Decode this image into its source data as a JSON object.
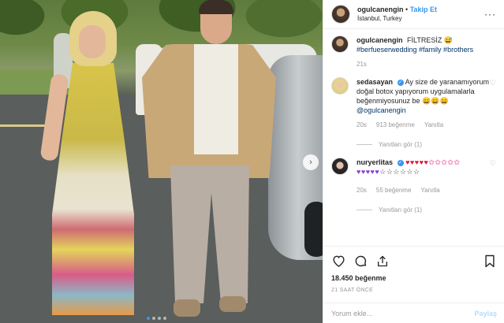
{
  "post": {
    "username": "ogulcanengin",
    "follow_label": "Takip Et",
    "separator": "•",
    "location": "İstanbul, Turkey",
    "menu_icon": "more-horizontal-icon"
  },
  "caption": {
    "username": "ogulcanengin",
    "text": "FİLTRESİZ",
    "emoji": "😅",
    "hashtags": "#berfueserwedding #family #brothers",
    "time": "21s"
  },
  "comments": [
    {
      "username": "sedasayan",
      "text": "Ay size de yaranamıyorum doğal botox yapıyorum uygulamalarla beğenmiyosunuz be 😄😄😄",
      "mention": "@ogulcanengin",
      "time": "20s",
      "likes": "913 beğenme",
      "reply": "Yanıtla",
      "view_replies": "Yanıtları gör (1)"
    },
    {
      "username": "nuryerlitas",
      "hearts_line1_red": "♥♥♥♥♥",
      "hearts_line1_pink": "✿✿✿✿✿",
      "hearts_line2_purple": "♥♥♥♥♥",
      "hearts_line2_dark": "☆☆☆☆☆☆",
      "time": "20s",
      "likes": "55 beğenme",
      "reply": "Yanıtla",
      "view_replies": "Yanıtları gör (1)"
    }
  ],
  "actions": {
    "likes": "18.450 beğenme",
    "time_ago": "21 SAAT ÖNCE"
  },
  "comment_input": {
    "placeholder": "Yorum ekle...",
    "post_label": "Paylaş"
  },
  "carousel": {
    "next_icon": "chevron-right-icon",
    "dots": 4,
    "active_dot": 0
  },
  "colors": {
    "accent": "#3897f0",
    "muted": "#999999",
    "hashtag": "#003569"
  }
}
